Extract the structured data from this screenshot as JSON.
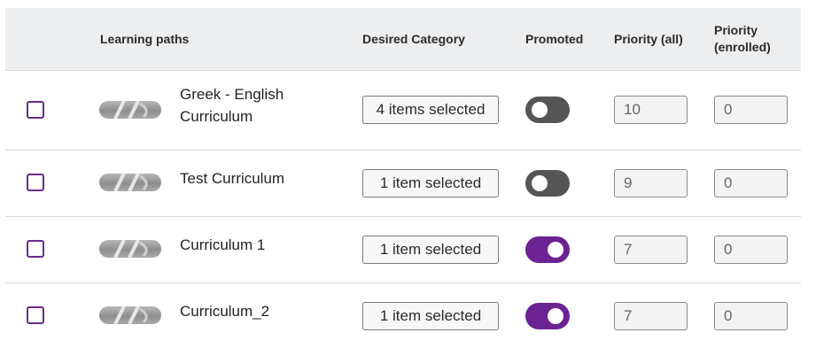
{
  "columns": {
    "learning_paths": "Learning paths",
    "desired_category": "Desired Category",
    "promoted": "Promoted",
    "priority_all": "Priority (all)",
    "priority_enrolled_line1": "Priority",
    "priority_enrolled_line2": "(enrolled)"
  },
  "rows": [
    {
      "name_line1": "Greek - English",
      "name_line2": "Curriculum",
      "category": "4 items selected",
      "promoted": false,
      "priority_all": "10",
      "priority_enrolled": "0"
    },
    {
      "name_line1": "Test Curriculum",
      "name_line2": "",
      "category": "1 item selected",
      "promoted": false,
      "priority_all": "9",
      "priority_enrolled": "0"
    },
    {
      "name_line1": "Curriculum 1",
      "name_line2": "",
      "category": "1 item selected",
      "promoted": true,
      "priority_all": "7",
      "priority_enrolled": "0"
    },
    {
      "name_line1": "Curriculum_2",
      "name_line2": "",
      "category": "1 item selected",
      "promoted": true,
      "priority_all": "7",
      "priority_enrolled": "0"
    }
  ],
  "colors": {
    "accent": "#6b2394",
    "toggle_off": "#555555",
    "checkbox_border": "#6b2b8c",
    "header_bg": "#eceef0"
  },
  "icons": {
    "thumbnail": "curriculum-thumbnail-icon"
  }
}
